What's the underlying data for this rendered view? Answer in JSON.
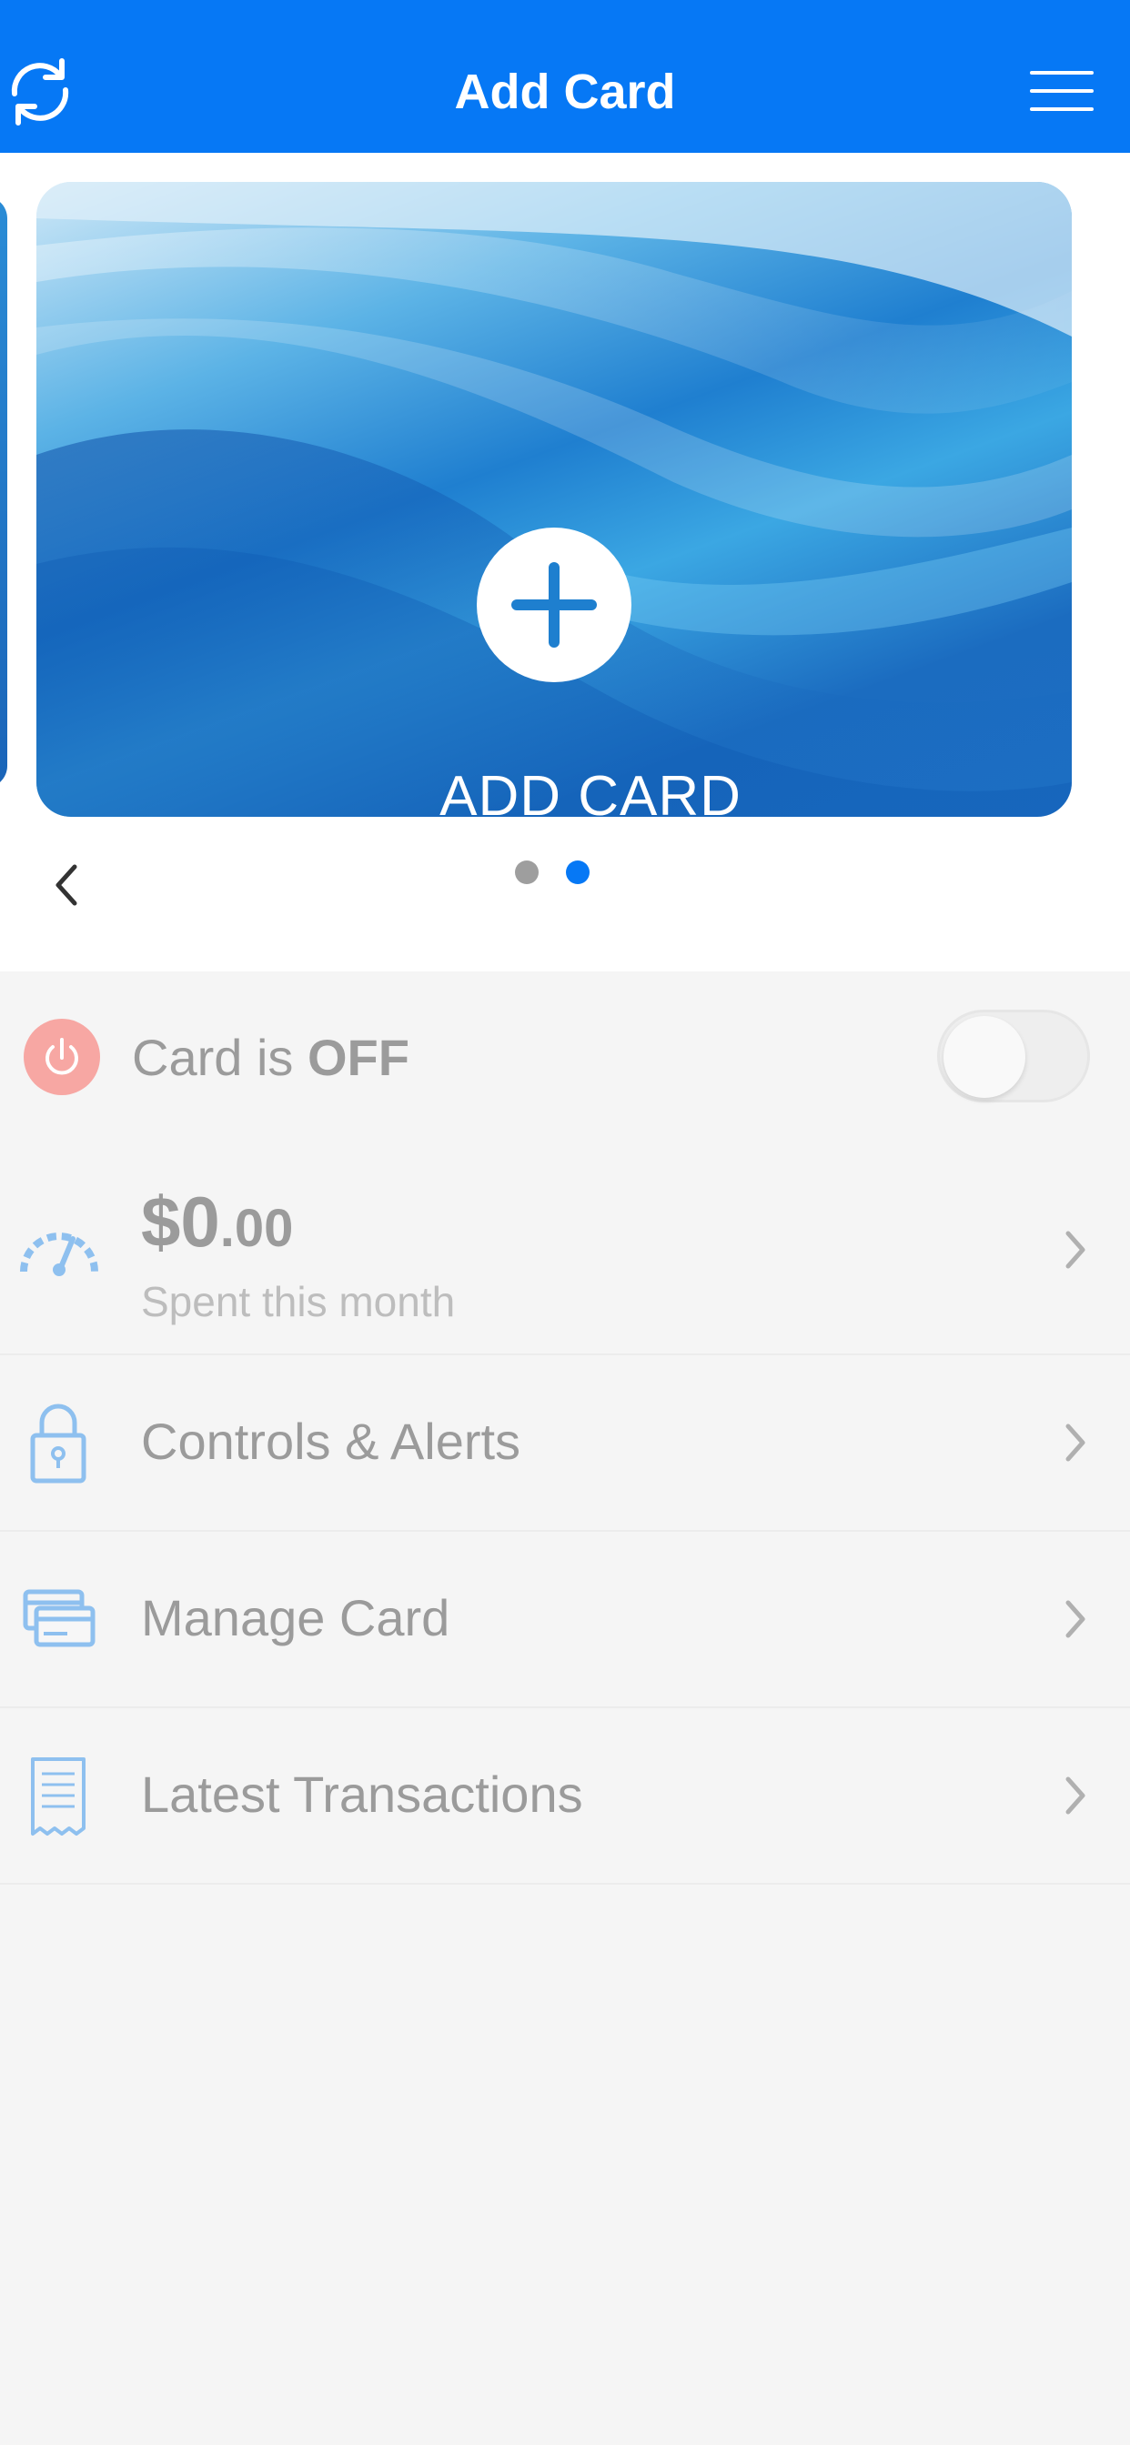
{
  "header": {
    "title": "Add Card",
    "background": "#0678f5",
    "refresh_icon": "refresh-icon",
    "menu_icon": "hamburger-menu-icon"
  },
  "carousel": {
    "add_card_label": "ADD CARD",
    "page_count": 2,
    "active_page": 2,
    "dot_inactive_color": "#9e9e9e",
    "dot_active_color": "#0678f5"
  },
  "card_status": {
    "prefix": "Card is ",
    "state": "OFF",
    "toggle_on": false,
    "icon_color": "#f7a7a3"
  },
  "spending": {
    "dollars": "$0",
    "cents": ".00",
    "label": "Spent this month"
  },
  "menu_items": [
    {
      "label": "Controls & Alerts",
      "icon": "lock-icon"
    },
    {
      "label": "Manage Card",
      "icon": "card-icon"
    },
    {
      "label": "Latest Transactions",
      "icon": "receipt-icon"
    }
  ],
  "accent_icon_color": "#8ec0ef"
}
